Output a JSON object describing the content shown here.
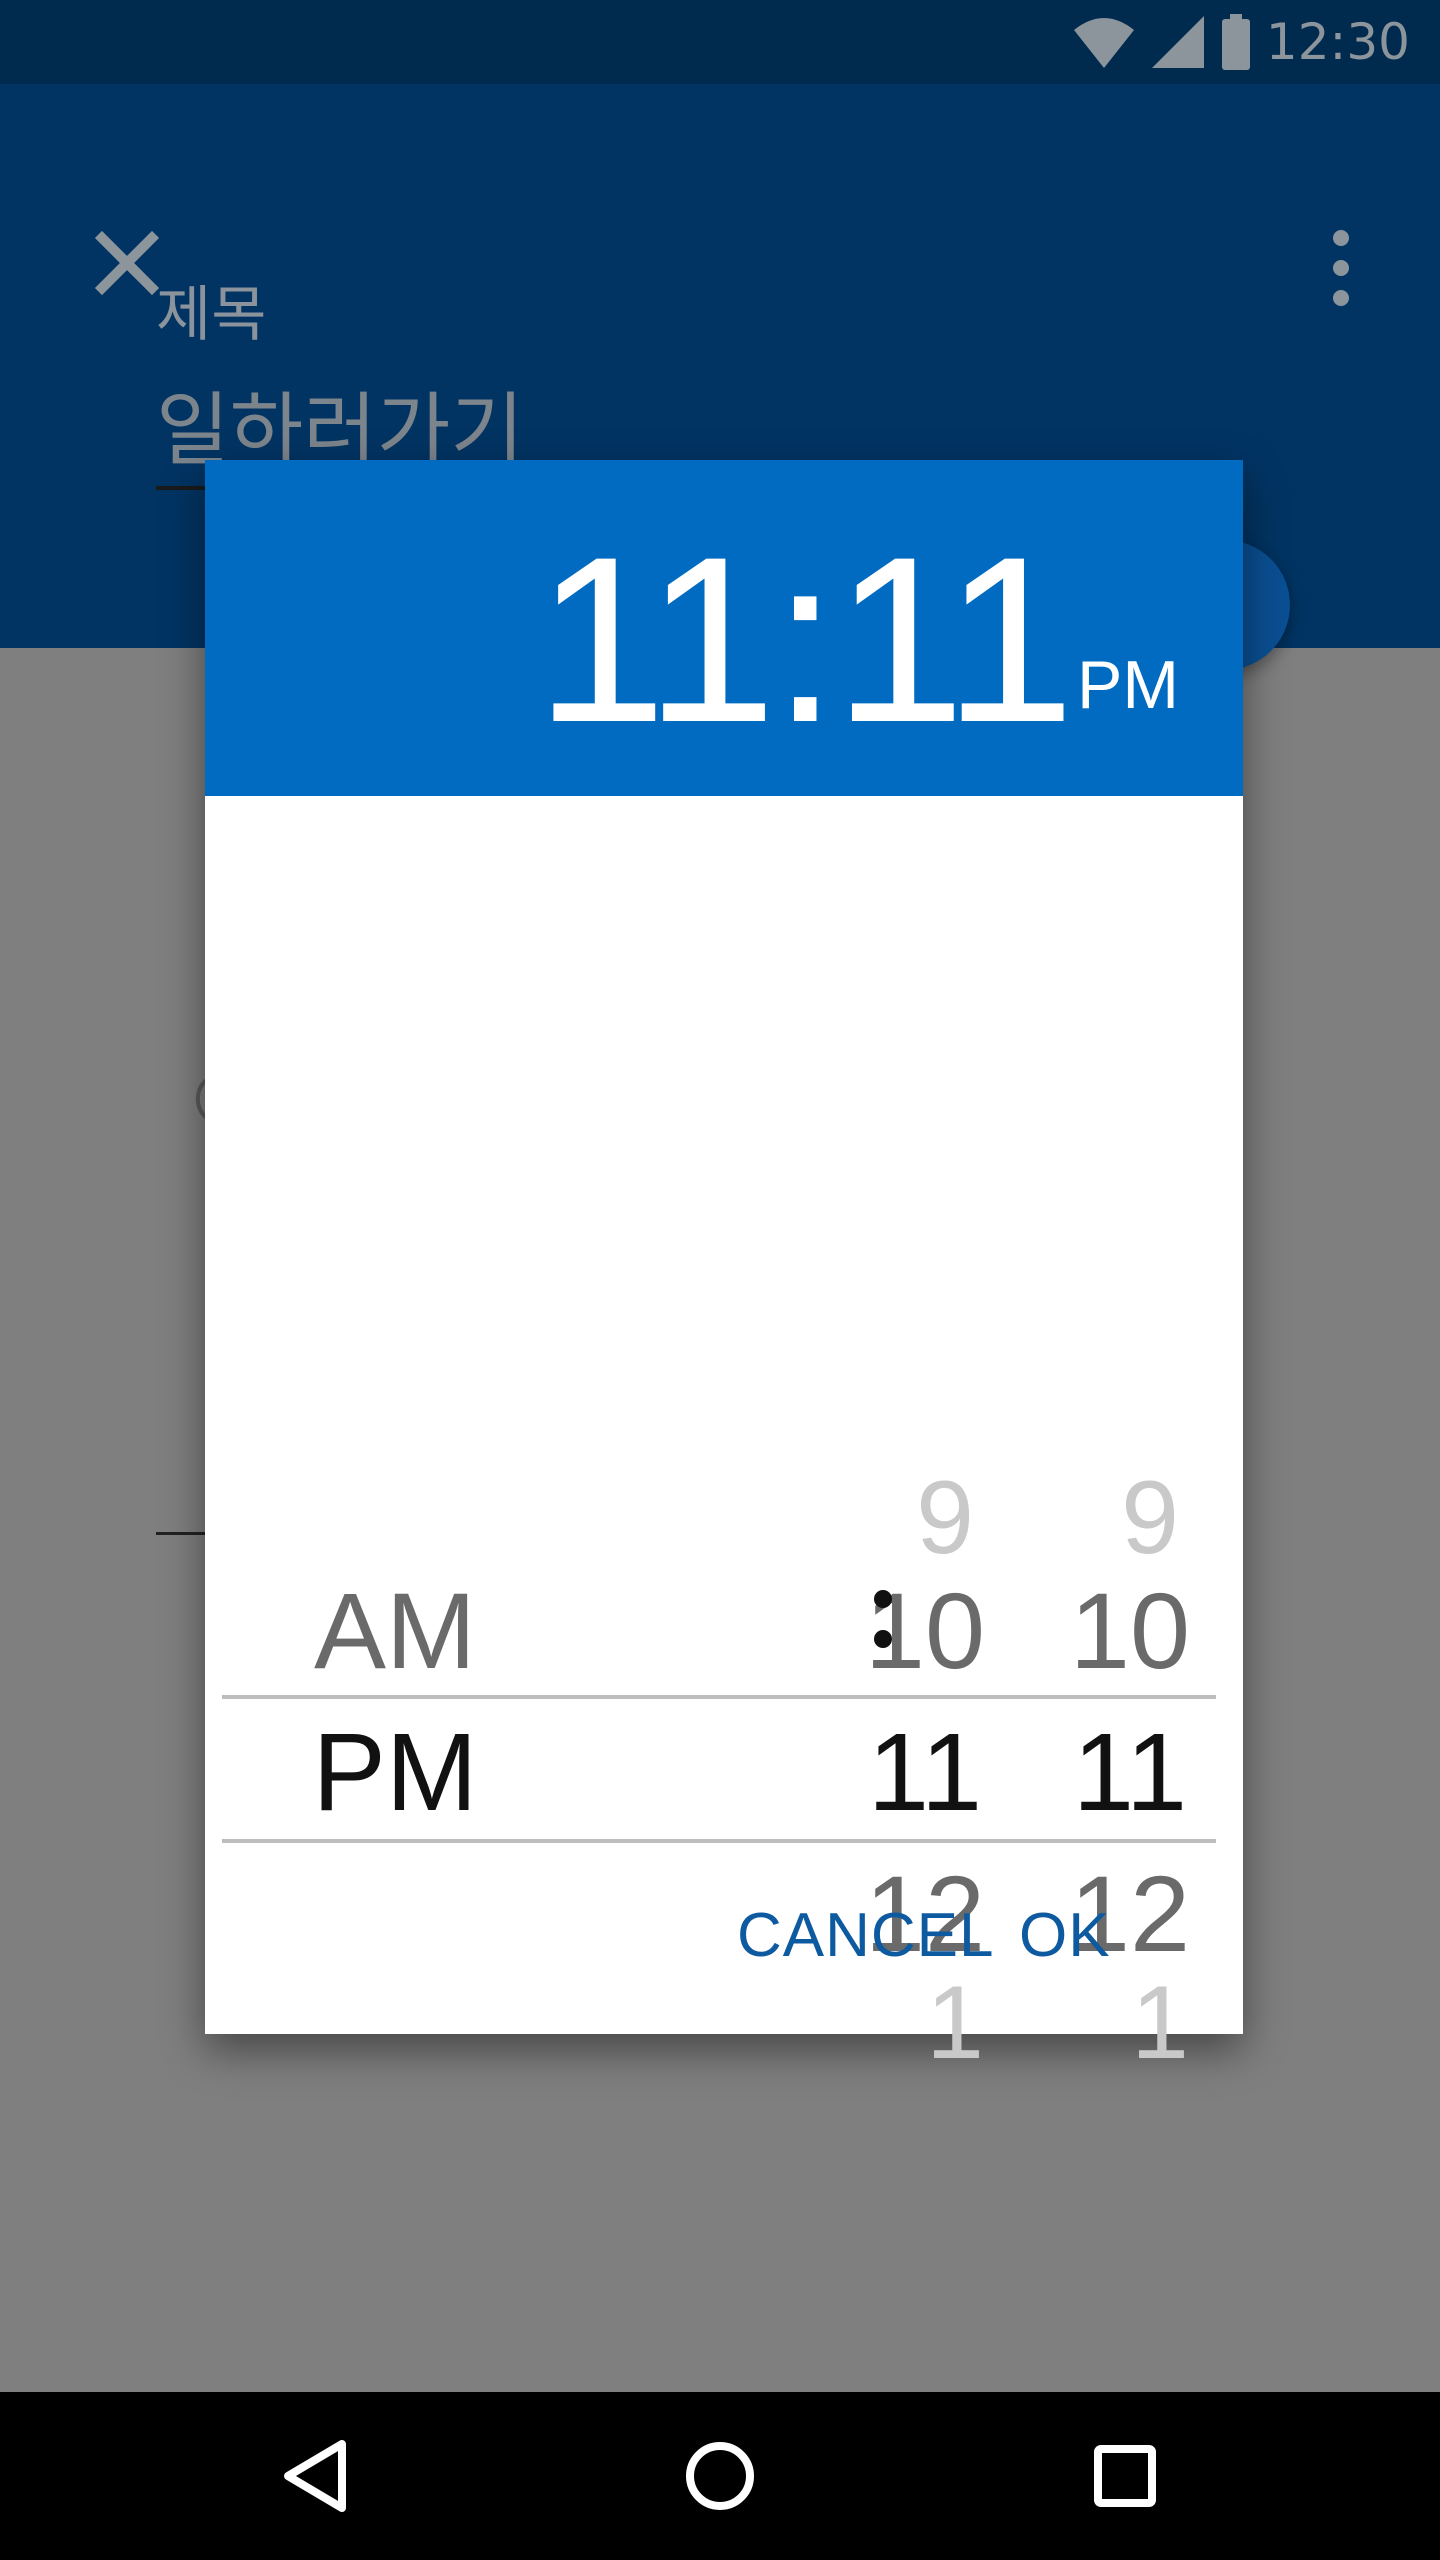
{
  "status_bar": {
    "time": "12:30",
    "icons": [
      "wifi-icon",
      "cell-signal-icon",
      "battery-icon"
    ]
  },
  "app_bar": {
    "close_icon": "close-icon",
    "more_icon": "more-vert-icon",
    "title_label": "제목",
    "title_value": "일하러가기"
  },
  "dialog": {
    "header": {
      "time": "11:11",
      "ampm": "PM"
    },
    "ampm_column": {
      "above": "AM",
      "selected": "PM"
    },
    "hour_column": {
      "far_above": "9",
      "near_above": "10",
      "selected": "11",
      "near_below": "12",
      "far_below": "1"
    },
    "separator": ":",
    "minute_column": {
      "far_above": "9",
      "near_above": "10",
      "selected": "11",
      "near_below": "12",
      "far_below": "1"
    },
    "buttons": {
      "cancel": "CANCEL",
      "ok": "OK"
    }
  },
  "nav_bar": {
    "icons": [
      "back-icon",
      "home-icon",
      "recents-icon"
    ]
  },
  "colors": {
    "header_blue": "#016bc2",
    "app_bar_dim": "#023463",
    "button_text": "#0d5aa0",
    "scrim_gray": "#7f7f7f"
  }
}
